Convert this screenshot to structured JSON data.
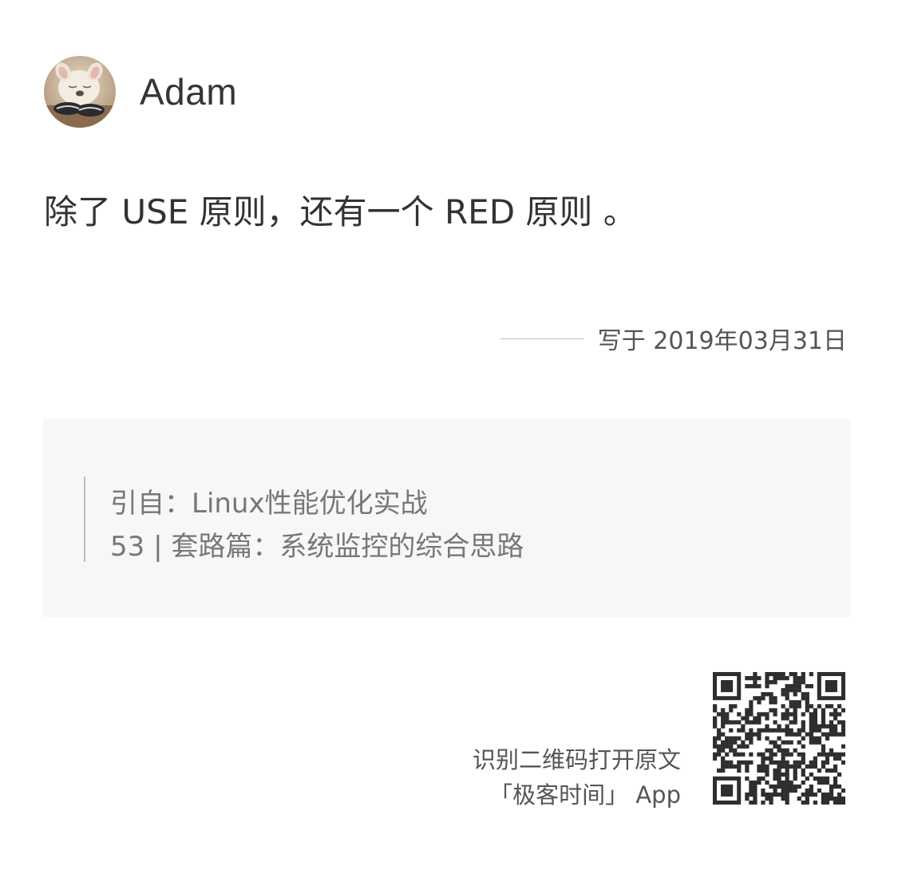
{
  "author": {
    "name": "Adam",
    "avatar_icon": "avatar-photo-icon"
  },
  "note": {
    "text": "除了 USE 原则，还有一个 RED 原则 。"
  },
  "date": {
    "label": "写于 2019年03月31日"
  },
  "quote": {
    "source_line": "引自：Linux性能优化实战",
    "article_line": "53 | 套路篇：系统监控的综合思路"
  },
  "footer": {
    "caption_line1": "识别二维码打开原文",
    "caption_line2": "「极客时间」 App",
    "qr_icon": "qr-code-icon"
  },
  "colors": {
    "text_primary": "#333333",
    "text_secondary": "#777777",
    "quote_background": "#f7f7f7"
  }
}
